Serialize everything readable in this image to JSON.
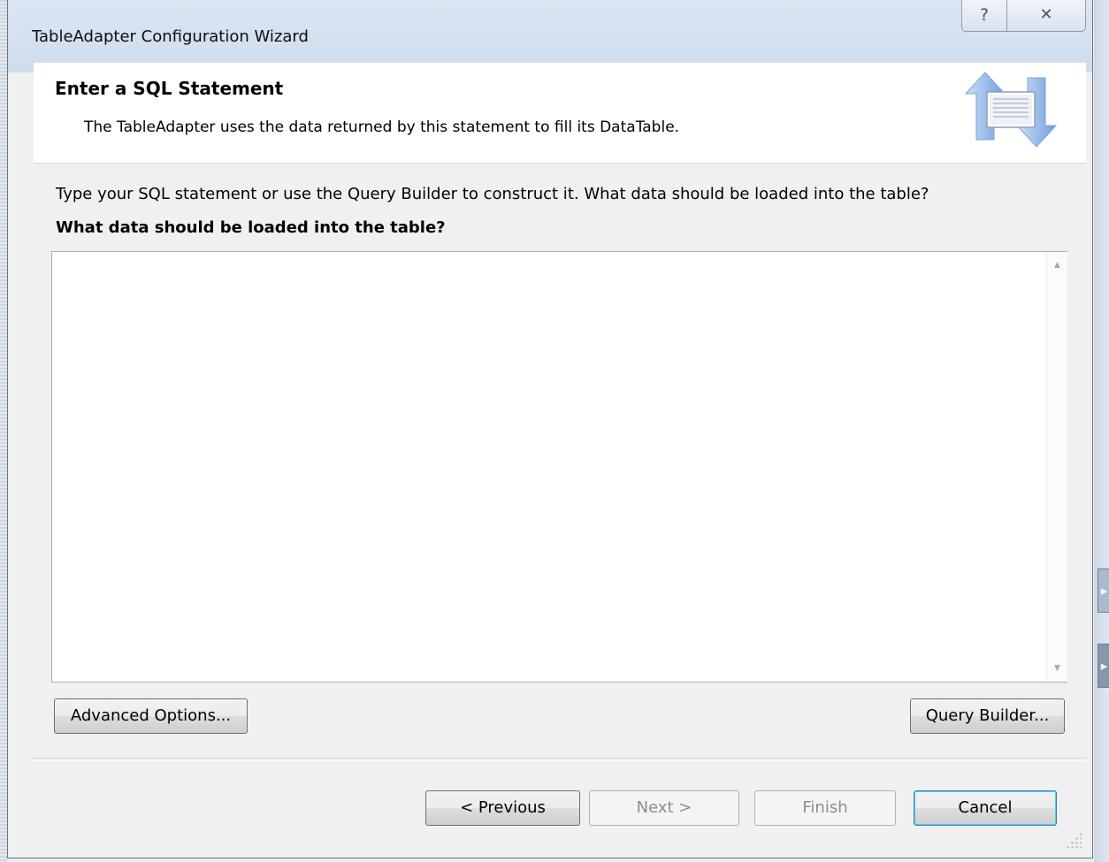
{
  "window": {
    "title": "TableAdapter Configuration Wizard",
    "help_glyph": "?",
    "close_glyph": "✕"
  },
  "header": {
    "title": "Enter a SQL Statement",
    "subtitle": "The TableAdapter uses the data returned by this statement to fill its DataTable."
  },
  "body": {
    "instruction": "Type your SQL statement or use the Query Builder to construct it. What data should be loaded into the table?",
    "question": "What data should be loaded into the table?",
    "sql_value": ""
  },
  "scrollbar": {
    "up_glyph": "▲",
    "down_glyph": "▼"
  },
  "buttons": {
    "advanced": "Advanced Options...",
    "query_builder": "Query Builder...",
    "previous": "< Previous",
    "next": "Next >",
    "finish": "Finish",
    "cancel": "Cancel"
  },
  "colors": {
    "title_bar": "#cfdceb",
    "default_button_border": "#3c7fb1",
    "disabled_text": "#8d8d8d"
  },
  "icons": {
    "wizard_graphic": "data-transfer-arrows-icon",
    "help": "help-icon",
    "close": "close-icon"
  }
}
